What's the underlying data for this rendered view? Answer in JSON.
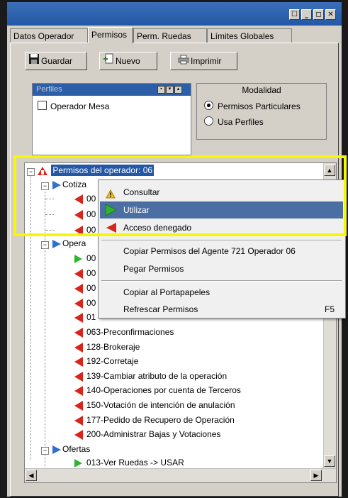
{
  "window": {
    "title_buttons": [
      "☐",
      "_",
      "◻",
      "✕"
    ]
  },
  "tabs": [
    {
      "label": "Datos Operador",
      "active": false
    },
    {
      "label": "Permisos",
      "active": true
    },
    {
      "label": "Perm. Ruedas",
      "active": false
    },
    {
      "label": "Límites Globales",
      "active": false
    }
  ],
  "toolbar": {
    "guardar": "Guardar",
    "nuevo": "Nuevo",
    "imprimir": "Imprimir"
  },
  "perfiles": {
    "title": "Perfiles",
    "items": [
      {
        "label": "Operador Mesa",
        "checked": false
      }
    ]
  },
  "modalidad": {
    "title": "Modalidad",
    "options": [
      {
        "label": "Permisos Particulares",
        "selected": true
      },
      {
        "label": "Usa Perfiles",
        "selected": false
      }
    ]
  },
  "tree": {
    "root": "Permisos del operador: 06",
    "groups": [
      {
        "label": "Cotiza",
        "items": [
          "00",
          "00",
          "00"
        ]
      },
      {
        "label": "Opera",
        "items": [
          "00",
          "00",
          "00",
          "00",
          "01",
          "063-Preconfirmaciones",
          "128-Brokeraje",
          "192-Corretaje",
          "139-Cambiar atributo de la operación",
          "140-Operaciones por cuenta de Terceros",
          "150-Votación de intención de anulación",
          "177-Pedido de Recupero de Operación",
          "200-Administrar Bajas y Votaciones"
        ]
      },
      {
        "label": "Ofertas",
        "items": [
          "013-Ver Ruedas -> USAR"
        ]
      }
    ]
  },
  "context_menu": {
    "items": [
      {
        "label": "Consultar",
        "icon": "warning-icon",
        "shortcut": ""
      },
      {
        "label": "Utilizar",
        "icon": "play-green-icon",
        "shortcut": "",
        "highlighted": true
      },
      {
        "label": "Acceso denegado",
        "icon": "deny-red-icon",
        "shortcut": ""
      },
      {
        "label": "Copiar Permisos del Agente 721 Operador 06",
        "icon": "",
        "shortcut": ""
      },
      {
        "label": "Pegar Permisos",
        "icon": "",
        "shortcut": ""
      },
      {
        "label": "Copiar al Portapapeles",
        "icon": "",
        "shortcut": ""
      },
      {
        "label": "Refrescar Permisos",
        "icon": "",
        "shortcut": "F5"
      }
    ]
  },
  "colors": {
    "highlight_border": "#f7f705",
    "menu_selection": "#4b6fa3",
    "deny": "#d8251b",
    "allow": "#2db52d"
  }
}
